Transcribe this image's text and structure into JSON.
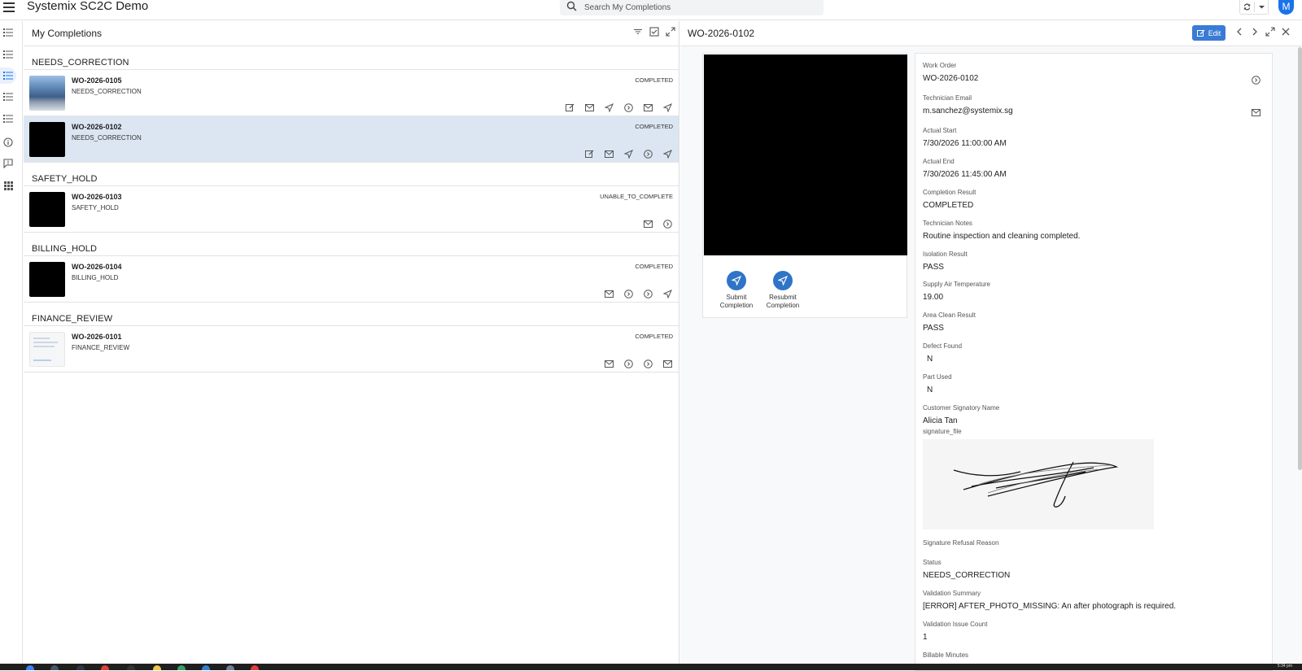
{
  "app": {
    "title": "Systemix SC2C Demo",
    "search_placeholder": "Search My Completions",
    "avatar_initial": "M"
  },
  "list": {
    "title": "My Completions",
    "groups": [
      {
        "name": "NEEDS_CORRECTION",
        "rows": [
          {
            "wo": "WO-2026-0105",
            "status": "NEEDS_CORRECTION",
            "result": "COMPLETED"
          },
          {
            "wo": "WO-2026-0102",
            "status": "NEEDS_CORRECTION",
            "result": "COMPLETED"
          }
        ]
      },
      {
        "name": "SAFETY_HOLD",
        "rows": [
          {
            "wo": "WO-2026-0103",
            "status": "SAFETY_HOLD",
            "result": "UNABLE_TO_COMPLETE"
          }
        ]
      },
      {
        "name": "BILLING_HOLD",
        "rows": [
          {
            "wo": "WO-2026-0104",
            "status": "BILLING_HOLD",
            "result": "COMPLETED"
          }
        ]
      },
      {
        "name": "FINANCE_REVIEW",
        "rows": [
          {
            "wo": "WO-2026-0101",
            "status": "FINANCE_REVIEW",
            "result": "COMPLETED"
          }
        ]
      }
    ]
  },
  "detail": {
    "title": "WO-2026-0102",
    "edit_label": "Edit",
    "actions": {
      "submit_l1": "Submit",
      "submit_l2": "Completion",
      "resubmit_l1": "Resubmit",
      "resubmit_l2": "Completion"
    },
    "fields": {
      "work_order": {
        "label": "Work Order",
        "value": "WO-2026-0102"
      },
      "tech_email": {
        "label": "Technician Email",
        "value": "m.sanchez@systemix.sg"
      },
      "actual_start": {
        "label": "Actual Start",
        "value": "7/30/2026 11:00:00 AM"
      },
      "actual_end": {
        "label": "Actual End",
        "value": "7/30/2026 11:45:00 AM"
      },
      "completion_result": {
        "label": "Completion Result",
        "value": "COMPLETED"
      },
      "tech_notes": {
        "label": "Technician Notes",
        "value": "Routine inspection and cleaning completed."
      },
      "isolation_result": {
        "label": "Isolation Result",
        "value": "PASS"
      },
      "supply_air_temp": {
        "label": "Supply Air Temperature",
        "value": "19.00"
      },
      "area_clean_result": {
        "label": "Area Clean Result",
        "value": "PASS"
      },
      "defect_found": {
        "label": "Defect Found",
        "value": "N"
      },
      "part_used": {
        "label": "Part Used",
        "value": "N"
      },
      "customer_signatory": {
        "label": "Customer Signatory Name",
        "value": "Alicia Tan"
      },
      "signature_file": {
        "label": "signature_file"
      },
      "signature_refusal": {
        "label": "Signature Refusal Reason"
      },
      "status": {
        "label": "Status",
        "value": "NEEDS_CORRECTION"
      },
      "validation_summary": {
        "label": "Validation Summary",
        "value": "[ERROR] AFTER_PHOTO_MISSING: An after photograph is required."
      },
      "validation_issue_count": {
        "label": "Validation Issue Count",
        "value": "1"
      },
      "billable_minutes": {
        "label": "Billable Minutes"
      }
    }
  },
  "system": {
    "clock": "5:34 pm"
  },
  "colors": {
    "accent": "#3a7bd5",
    "fab": "#2f74c8",
    "selected_row": "#dbe6f2"
  }
}
